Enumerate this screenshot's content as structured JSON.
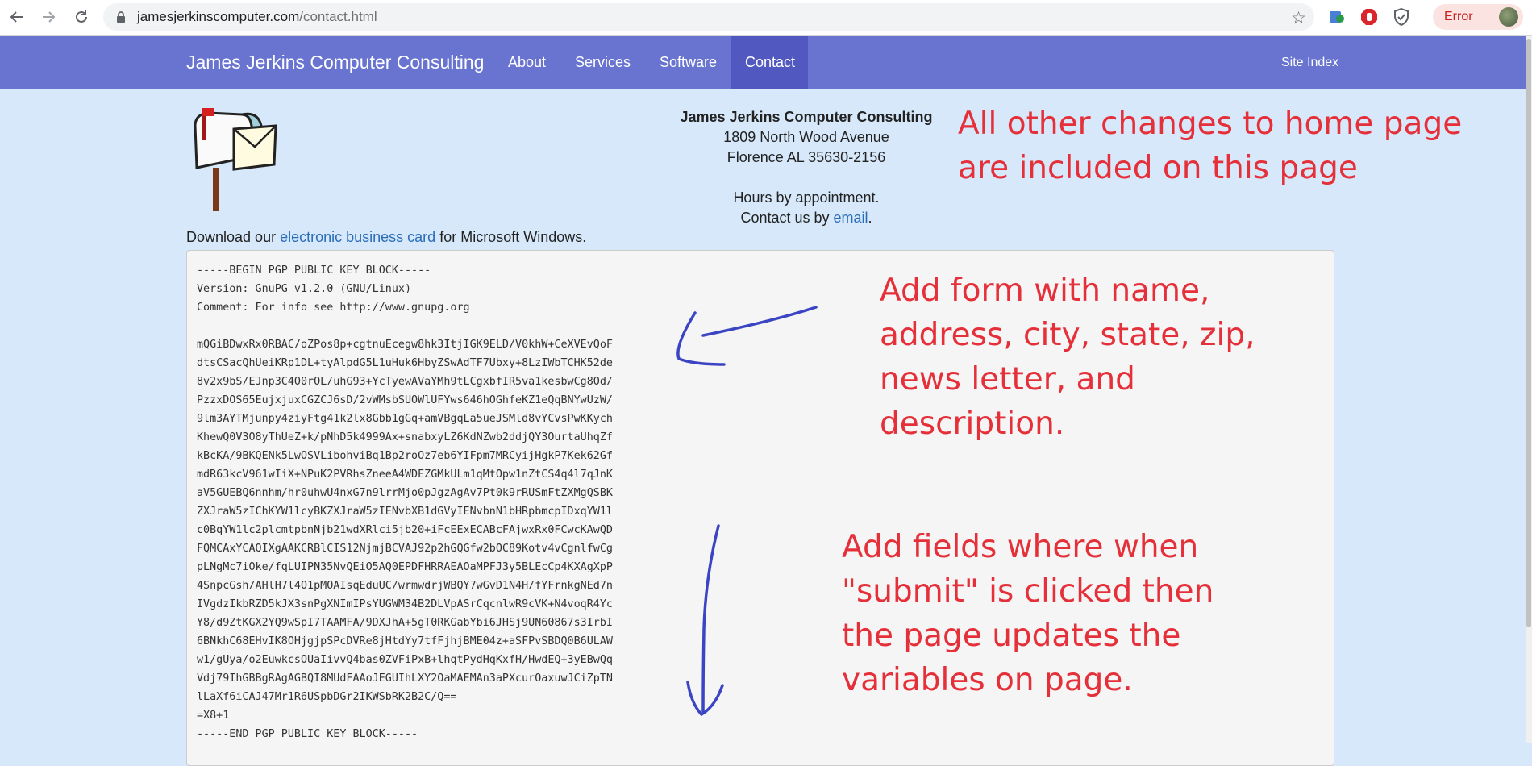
{
  "browser": {
    "url_host": "jamesjerkinscomputer.com",
    "url_path": "/contact.html",
    "error_label": "Error",
    "icons": [
      "back-arrow-icon",
      "forward-arrow-icon",
      "reload-icon",
      "lock-icon",
      "bookmark-star-icon",
      "extension-icon",
      "stop-sign-icon",
      "shield-icon",
      "profile-avatar-icon"
    ]
  },
  "nav": {
    "brand": "James Jerkins Computer Consulting",
    "links": [
      "About",
      "Services",
      "Software",
      "Contact"
    ],
    "active": "Contact",
    "site_index": "Site Index"
  },
  "contact": {
    "company": "James Jerkins Computer Consulting",
    "street": "1809 North Wood Avenue",
    "city_line": "Florence AL 35630-2156",
    "hours": "Hours by appointment.",
    "contact_prefix": "Contact us by ",
    "contact_link": "email",
    "contact_suffix": "."
  },
  "download": {
    "prefix": "Download our ",
    "link": "electronic business card",
    "suffix": " for Microsoft Windows."
  },
  "pgp_lines": [
    "-----BEGIN PGP PUBLIC KEY BLOCK-----",
    "Version: GnuPG v1.2.0 (GNU/Linux)",
    "Comment: For info see http://www.gnupg.org",
    "",
    "mQGiBDwxRx0RBAC/oZPos8p+cgtnuEcegw8hk3ItjIGK9ELD/V0khW+CeXVEvQoF",
    "dtsCSacQhUeiKRp1DL+tyAlpdG5L1uHuk6HbyZSwAdTF7Ubxy+8LzIWbTCHK52de",
    "8v2x9bS/EJnp3C4O0rOL/uhG93+YcTyewAVaYMh9tLCgxbfIR5va1kesbwCg8Od/",
    "PzzxDOS65EujxjuxCGZCJ6sD/2vWMsbSUOWlUFYws646hOGhfeKZ1eQqBNYwUzW/",
    "9lm3AYTMjunpy4ziyFtg41k2lx8Gbb1gGq+amVBgqLa5ueJSMld8vYCvsPwKKych",
    "KhewQ0V3O8yThUeZ+k/pNhD5k4999Ax+snabxyLZ6KdNZwb2ddjQY3OurtaUhqZf",
    "kBcKA/9BKQENk5LwOSVLibohviBq1Bp2roOz7eb6YIFpm7MRCyijHgkP7Kek62Gf",
    "mdR63kcV961wIiX+NPuK2PVRhsZneeA4WDEZGMkULm1qMtOpw1nZtCS4q4l7qJnK",
    "aV5GUEBQ6nnhm/hr0uhwU4nxG7n9lrrMjo0pJgzAgAv7Pt0k9rRUSmFtZXMgQSBK",
    "ZXJraW5zIChKYW1lcyBKZXJraW5zIENvbXB1dGVyIENvbnN1bHRpbmcpIDxqYW1l",
    "c0BqYW1lc2plcmtpbnNjb21wdXRlci5jb20+iFcEExECABcFAjwxRx0FCwcKAwQD",
    "FQMCAxYCAQIXgAAKCRBlCIS12NjmjBCVAJ92p2hGQGfw2bOC89Kotv4vCgnlfwCg",
    "pLNgMc7iOke/fqLUIPN35NvQEiO5AQ0EPDFHRRAEAOaMPFJ3y5BLEcCp4KXAgXpP",
    "4SnpcGsh/AHlH7l4O1pMOAIsqEduUC/wrmwdrjWBQY7wGvD1N4H/fYFrnkgNEd7n",
    "IVgdzIkbRZD5kJX3snPgXNImIPsYUGWM34B2DLVpASrCqcnlwR9cVK+N4voqR4Yc",
    "Y8/d9ZtKGX2YQ9wSpI7TAAMFA/9DXJhA+5gT0RKGabYbi6JHSj9UN60867s3IrbI",
    "6BNkhC68EHvIK8OHjgjpSPcDVRe8jHtdYy7tfFjhjBME04z+aSFPvSBDQ0B6ULAW",
    "w1/gUya/o2EuwkcsOUaIivvQ4bas0ZVFiPxB+lhqtPydHqKxfH/HwdEQ+3yEBwQq",
    "Vdj79IhGBBgRAgAGBQI8MUdFAAoJEGUIhLXY2OaMAEMAn3aPXcurOaxuwJCiZpTN",
    "lLaXf6iCAJ47Mr1R6USpbDGr2IKWSbRK2B2C/Q==",
    "=X8+1",
    "-----END PGP PUBLIC KEY BLOCK-----"
  ],
  "annotations": {
    "note1": [
      "All other changes to home page",
      "are included on this page"
    ],
    "note2": [
      "Add form with name,",
      "address, city, state, zip,",
      "news letter, and",
      "description."
    ],
    "note3": [
      "Add fields where when",
      "\"submit\" is clicked then",
      "the page updates the",
      "variables on page."
    ]
  },
  "colors": {
    "page_bg": "#d6e8fa",
    "navbar": "#6874d0",
    "navbar_active": "#5158bf",
    "link": "#2a6cb8",
    "annotation_red": "#e5303a",
    "annotation_blue": "#3b45c4"
  }
}
